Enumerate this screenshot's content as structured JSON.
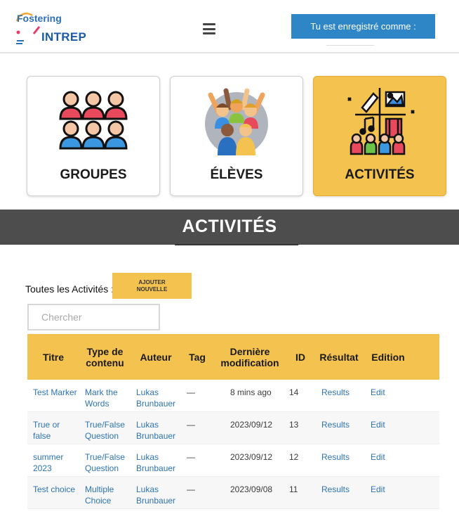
{
  "header": {
    "logo_top": "Fostering",
    "logo_bottom": "INTREP",
    "user_label": "Tu est enregistré comme :"
  },
  "cards": [
    {
      "label": "GROUPES",
      "icon": "group-icon",
      "active": false
    },
    {
      "label": "ÉLÈVES",
      "icon": "students-icon",
      "active": false
    },
    {
      "label": "ACTIVITÉS",
      "icon": "activities-icon",
      "active": true
    }
  ],
  "section": {
    "title": "ACTIVITÉS"
  },
  "toolbar": {
    "all_label": "Toutes les Activités :",
    "add_label_line1": "AJOUTER",
    "add_label_line2": "NOUVELLE",
    "search_placeholder": "Chercher"
  },
  "table": {
    "headers": [
      "Titre",
      "Type de contenu",
      "Auteur",
      "Tag",
      "Dernière modification",
      "ID",
      "Résultat",
      "Edition"
    ],
    "rows": [
      {
        "titre": "Test Marker",
        "type": "Mark the Words",
        "auteur": "Lukas Brunbauer",
        "tag": "—",
        "mod": "8 mins ago",
        "id": "14",
        "res": "Results",
        "edit": "Edit"
      },
      {
        "titre": "True or false",
        "type": "True/False Question",
        "auteur": "Lukas Brunbauer",
        "tag": "—",
        "mod": "2023/09/12",
        "id": "13",
        "res": "Results",
        "edit": "Edit"
      },
      {
        "titre": "summer 2023",
        "type": "True/False Question",
        "auteur": "Lukas Brunbauer",
        "tag": "—",
        "mod": "2023/09/12",
        "id": "12",
        "res": "Results",
        "edit": "Edit"
      },
      {
        "titre": "Test choice",
        "type": "Multiple Choice",
        "auteur": "Lukas Brunbauer",
        "tag": "—",
        "mod": "2023/09/08",
        "id": "11",
        "res": "Results",
        "edit": "Edit"
      }
    ]
  },
  "colors": {
    "accent": "#f4c24f",
    "primary": "#2f86c7",
    "link": "#2d73b5",
    "section_bar": "#4d4d4d"
  }
}
